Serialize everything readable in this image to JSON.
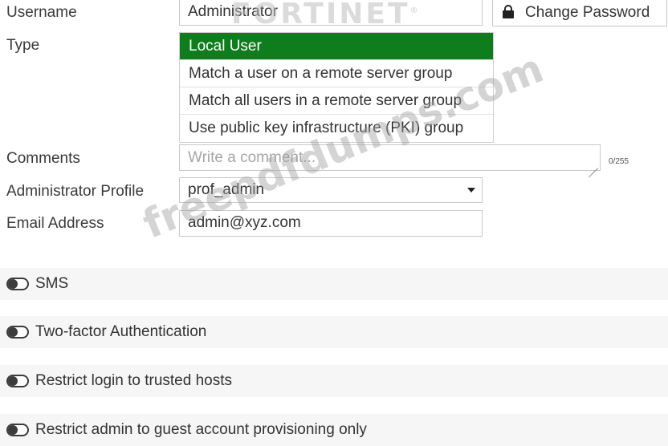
{
  "form": {
    "username_label": "Username",
    "username_value": "Administrator",
    "change_password_label": "Change Password",
    "type_label": "Type",
    "type_options": [
      {
        "label": "Local User",
        "selected": true
      },
      {
        "label": "Match a user on a remote server group",
        "selected": false
      },
      {
        "label": "Match all users in a remote server group",
        "selected": false
      },
      {
        "label": "Use public key infrastructure (PKI) group",
        "selected": false
      }
    ],
    "comments_label": "Comments",
    "comments_placeholder": "Write a comment...",
    "comments_counter": "0/255",
    "admin_profile_label": "Administrator Profile",
    "admin_profile_value": "prof_admin",
    "email_label": "Email Address",
    "email_value": "admin@xyz.com"
  },
  "toggles": [
    {
      "label": "SMS",
      "enabled": false
    },
    {
      "label": "Two-factor Authentication",
      "enabled": false
    },
    {
      "label": "Restrict login to trusted hosts",
      "enabled": false
    },
    {
      "label": "Restrict admin to guest account provisioning only",
      "enabled": false
    }
  ],
  "overlay": {
    "logo_text": "FORTINET",
    "watermark_text": "freepdfdumps.com"
  },
  "colors": {
    "selected_bg": "#0f7d1d",
    "band_bg": "#f6f6f6"
  }
}
